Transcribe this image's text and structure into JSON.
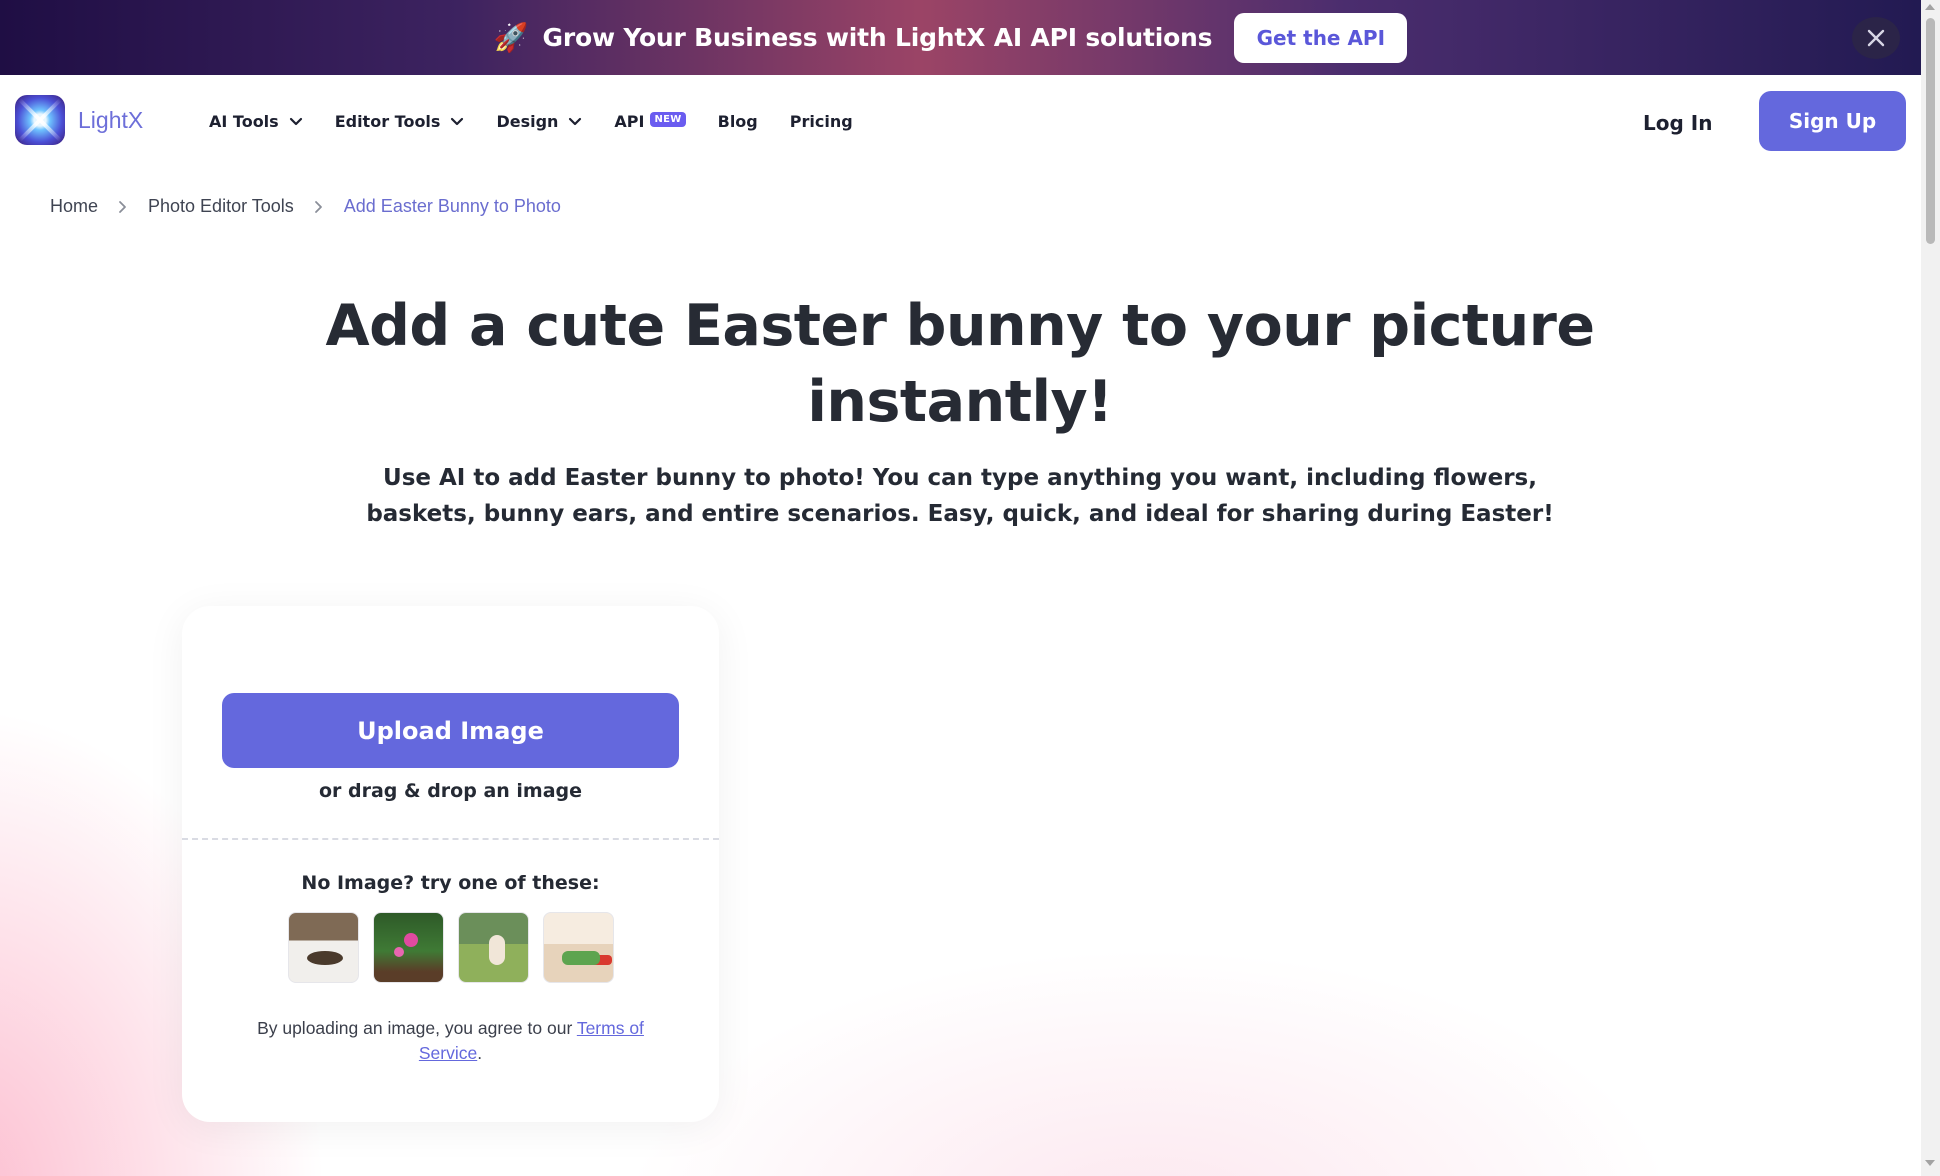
{
  "promo": {
    "rocket_icon": "rocket-icon",
    "text": "Grow Your Business with LightX AI API solutions",
    "button": "Get the API",
    "close_icon": "close-icon"
  },
  "nav": {
    "logo_text": "LightX",
    "menu": [
      {
        "label": "AI Tools"
      },
      {
        "label": "Editor Tools"
      },
      {
        "label": "Design"
      },
      {
        "label": "API",
        "badge": "NEW"
      },
      {
        "label": "Blog"
      },
      {
        "label": "Pricing"
      }
    ],
    "login": "Log In",
    "signup": "Sign Up"
  },
  "breadcrumb": {
    "items": [
      "Home",
      "Photo Editor Tools",
      "Add Easter Bunny to Photo"
    ]
  },
  "hero": {
    "title": "Add a cute Easter bunny to your picture instantly!",
    "subtitle": "Use AI to add Easter bunny to photo! You can type anything you want, including flowers, baskets, bunny ears, and entire scenarios. Easy, quick, and ideal for sharing during Easter!"
  },
  "upload": {
    "button": "Upload Image",
    "drag_drop": "or drag & drop an image",
    "try_text": "No Image? try one of these:",
    "terms_prefix": "By uploading an image, you agree to our ",
    "terms_link": "Terms of Service",
    "terms_suffix": "."
  },
  "colors": {
    "accent": "#6468dd",
    "text": "#252a34",
    "breadcrumb_active": "#6a6dcf"
  }
}
